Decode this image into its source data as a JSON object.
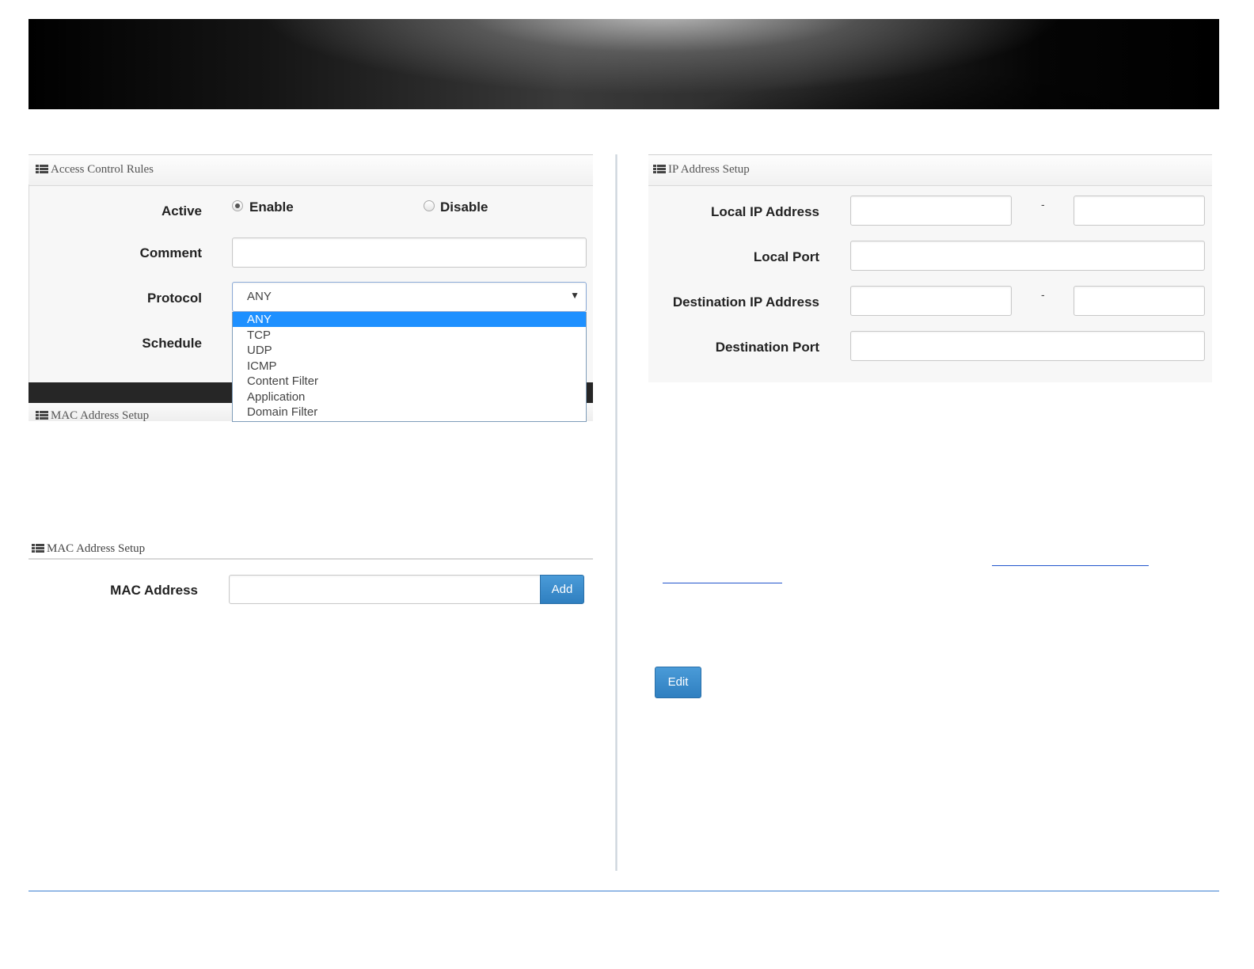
{
  "access_panel": {
    "title": "Access Control Rules",
    "active_label": "Active",
    "enable_label": "Enable",
    "disable_label": "Disable",
    "enable_selected": true,
    "comment_label": "Comment",
    "comment_value": "",
    "protocol_label": "Protocol",
    "protocol_value": "ANY",
    "protocol_options": [
      "ANY",
      "TCP",
      "UDP",
      "ICMP",
      "Content Filter",
      "Application",
      "Domain Filter"
    ],
    "schedule_label": "Schedule"
  },
  "mac_panel_behind": {
    "title": "MAC Address Setup"
  },
  "mac_panel": {
    "title": "MAC Address Setup",
    "mac_label": "MAC Address",
    "mac_value": "",
    "add_label": "Add"
  },
  "ip_panel": {
    "title": "IP Address Setup",
    "local_ip_label": "Local IP Address",
    "local_port_label": "Local Port",
    "dest_ip_label": "Destination IP Address",
    "dest_port_label": "Destination Port",
    "range_separator": "-"
  },
  "edit_button": {
    "label": "Edit"
  },
  "colors": {
    "accent_blue": "#3b7fd1",
    "select_highlight": "#1e90ff",
    "button_blue": "#3a8ccc"
  }
}
